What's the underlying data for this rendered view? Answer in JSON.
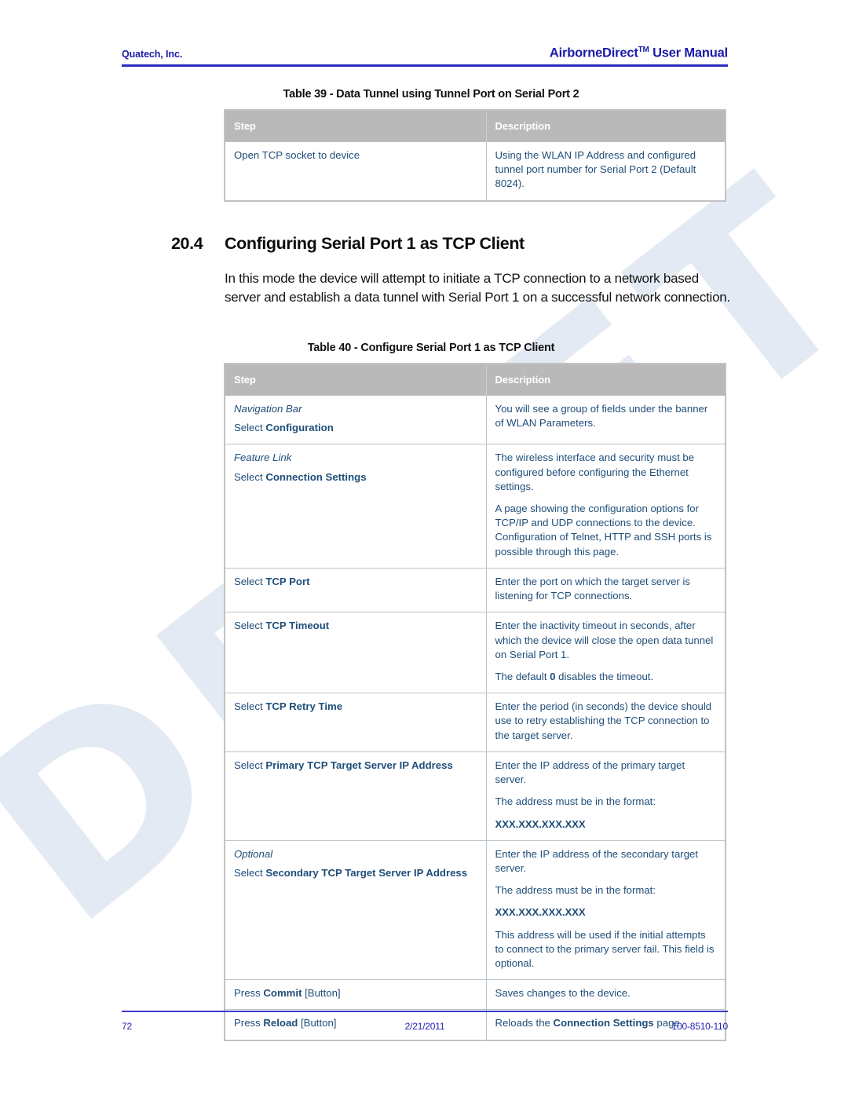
{
  "header": {
    "left": "Quatech, Inc.",
    "right_main": "AirborneDirect",
    "right_tm": "TM",
    "right_tail": " User Manual"
  },
  "watermark": {
    "text": "DRAFT"
  },
  "table39": {
    "caption": "Table 39 - Data Tunnel using Tunnel Port on Serial Port 2",
    "columns": [
      "Step",
      "Description"
    ],
    "rows": [
      {
        "step_plain": "Open TCP socket to device",
        "desc": "Using the WLAN IP Address and configured tunnel port number for Serial Port 2 (Default 8024)."
      }
    ]
  },
  "section": {
    "number": "20.4",
    "title": "Configuring Serial Port 1 as TCP Client",
    "paragraph": "In this mode the device will attempt to initiate a TCP connection to a network based server and establish a data tunnel with Serial Port 1 on a successful network connection."
  },
  "table40": {
    "caption": "Table 40 - Configure Serial Port 1 as TCP Client",
    "columns": [
      "Step",
      "Description"
    ],
    "rows": [
      {
        "step_italic": "Navigation Bar",
        "step_lead": "Select ",
        "step_bold": "Configuration",
        "desc_1": "You will see a group of fields under the banner of WLAN Parameters."
      },
      {
        "step_italic": "Feature Link",
        "step_lead": "Select ",
        "step_bold": "Connection Settings",
        "desc_1": "The wireless interface and security must be configured before configuring the Ethernet settings.",
        "desc_2": "A page showing the configuration options for TCP/IP and UDP connections to the device. Configuration of Telnet, HTTP and SSH ports is possible through this page."
      },
      {
        "step_lead": "Select ",
        "step_bold": "TCP Port",
        "desc_1": "Enter the port on which the target server is listening for TCP connections."
      },
      {
        "step_lead": "Select ",
        "step_bold": "TCP Timeout",
        "desc_1": "Enter the inactivity timeout in seconds, after which the device will close the open data tunnel on Serial Port 1.",
        "desc_2_pre": "The default ",
        "desc_2_bold": "0",
        "desc_2_post": " disables the timeout."
      },
      {
        "step_lead": "Select ",
        "step_bold": "TCP Retry Time",
        "desc_1": "Enter the period (in seconds) the device should use to retry establishing the TCP connection to the target server."
      },
      {
        "step_lead": "Select ",
        "step_bold": "Primary TCP Target Server IP Address",
        "desc_1": "Enter the IP address of the primary target server.",
        "desc_2": "The address must be in the format:",
        "desc_3": "XXX.XXX.XXX.XXX"
      },
      {
        "step_italic": "Optional",
        "step_lead": "Select ",
        "step_bold": "Secondary TCP Target Server IP Address",
        "desc_1": "Enter the IP address of the secondary target server.",
        "desc_2": "The address must be in the format:",
        "desc_3": "XXX.XXX.XXX.XXX",
        "desc_4": "This address will be used if the initial attempts to connect to the primary server fail. This field is optional."
      },
      {
        "step_lead": "Press ",
        "step_bold": "Commit",
        "step_tail": " [Button]",
        "desc_1": "Saves changes to the device."
      },
      {
        "step_lead": "Press ",
        "step_bold": "Reload",
        "step_tail": " [Button]",
        "desc_1_pre": "Reloads the ",
        "desc_1_bold": "Connection Settings",
        "desc_1_post": " page."
      }
    ]
  },
  "footer": {
    "page_number": "72",
    "date": "2/21/2011",
    "doc_number": "100-8510-110"
  },
  "colors": {
    "header_blue": "#1a1aa8",
    "rule_blue": "#2b2bbe",
    "table_text_blue": "#1f4e79",
    "table_header_gray": "#b9b9b9",
    "watermark_blue": "#e3eaf3",
    "footer_blue": "#2323b4"
  }
}
